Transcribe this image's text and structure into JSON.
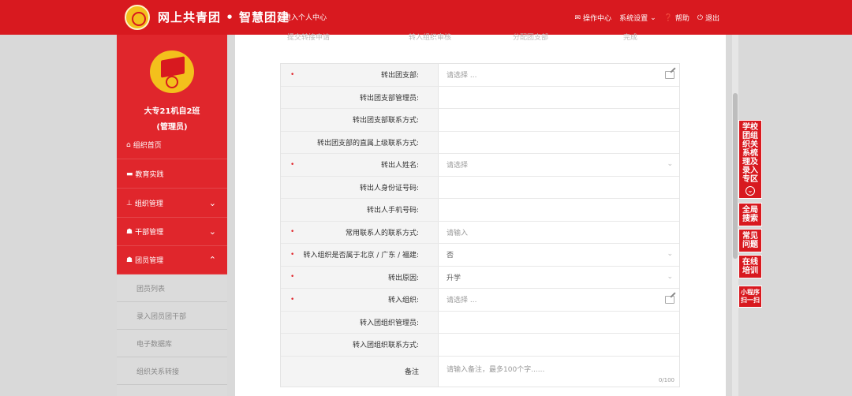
{
  "header": {
    "brand": "网上共青团 • 智慧团建",
    "personal_center": "进入个人中心",
    "nav": [
      {
        "icon": "mail-icon",
        "label": "操作中心"
      },
      {
        "icon": "none",
        "label": "系统设置"
      },
      {
        "icon": "help-icon",
        "label": "帮助"
      },
      {
        "icon": "power-icon",
        "label": "退出"
      }
    ]
  },
  "sidebar": {
    "org_name": "大专21机自2班",
    "org_role": "(管理员)",
    "menu": [
      {
        "label": "组织首页",
        "icon": "home-icon"
      },
      {
        "label": "教育实践",
        "icon": "folder-icon"
      },
      {
        "label": "组织管理",
        "icon": "org-chart-icon"
      },
      {
        "label": "干部管理",
        "icon": "users-icon"
      },
      {
        "label": "团员管理",
        "icon": "users-icon"
      }
    ],
    "submenu": [
      "团员列表",
      "录入团员团干部",
      "电子数据库",
      "组织关系转接"
    ]
  },
  "steps": [
    "提交转接申请",
    "转入组织审核",
    "分配团支部",
    "完成"
  ],
  "form": {
    "rows": [
      {
        "label": "转出团支部:",
        "required": true,
        "value": "请选择 ...",
        "placeholder": true,
        "control": "edit"
      },
      {
        "label": "转出团支部管理员:",
        "required": false,
        "value": "",
        "placeholder": false,
        "control": "none"
      },
      {
        "label": "转出团支部联系方式:",
        "required": false,
        "value": "",
        "placeholder": false,
        "control": "none"
      },
      {
        "label": "转出团支部的直属上级联系方式:",
        "required": false,
        "value": "",
        "placeholder": false,
        "control": "none"
      },
      {
        "label": "转出人姓名:",
        "required": true,
        "value": "请选择",
        "placeholder": true,
        "control": "select"
      },
      {
        "label": "转出人身份证号码:",
        "required": false,
        "value": "",
        "placeholder": false,
        "control": "none"
      },
      {
        "label": "转出人手机号码:",
        "required": false,
        "value": "",
        "placeholder": false,
        "control": "none"
      },
      {
        "label": "常用联系人的联系方式:",
        "required": true,
        "value": "请输入",
        "placeholder": true,
        "control": "none"
      },
      {
        "label": "转入组织是否属于北京 / 广东 / 福建:",
        "required": true,
        "value": "否",
        "placeholder": false,
        "control": "select"
      },
      {
        "label": "转出原因:",
        "required": true,
        "value": "升学",
        "placeholder": false,
        "control": "select"
      },
      {
        "label": "转入组织:",
        "required": true,
        "value": "请选择 ...",
        "placeholder": true,
        "control": "edit"
      },
      {
        "label": "转入团组织管理员:",
        "required": false,
        "value": "",
        "placeholder": false,
        "control": "none"
      },
      {
        "label": "转入团组织联系方式:",
        "required": false,
        "value": "",
        "placeholder": false,
        "control": "none"
      }
    ],
    "remark_label": "备注",
    "remark_placeholder": "请输入备注，最多100个字......",
    "remark_counter": "0/100"
  },
  "float_tools": [
    {
      "label": "学校团组织关系梳理及录入专区",
      "lines": [
        "学校",
        "团组",
        "织关",
        "系梳",
        "理及",
        "录入",
        "专区"
      ]
    },
    {
      "label": "全局搜索",
      "lines": [
        "全局",
        "搜索"
      ]
    },
    {
      "label": "常见问题",
      "lines": [
        "常见",
        "问题"
      ]
    },
    {
      "label": "在线培训",
      "lines": [
        "在线",
        "培训"
      ]
    },
    {
      "label": "小程序扫一扫",
      "lines": [
        "小程序",
        "扫一扫"
      ]
    }
  ]
}
